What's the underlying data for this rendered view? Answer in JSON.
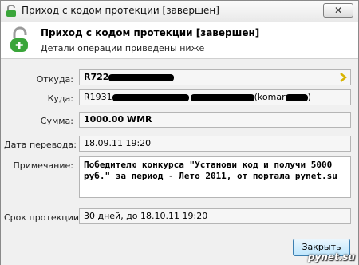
{
  "window": {
    "title": "Приход с кодом протекции [завершен]",
    "close_label": "✕"
  },
  "header": {
    "title": "Приход с кодом протекции [завершен]",
    "subtitle": "Детали операции приведены ниже"
  },
  "fields": {
    "from_label": "Откуда:",
    "from_value": "R722",
    "to_label": "Куда:",
    "to_value_start": "R1931",
    "to_value_mid": "(komar",
    "to_value_end": ")",
    "amount_label": "Сумма:",
    "amount_value": "1000.00 WMR",
    "date_label": "Дата перевода:",
    "date_value": "18.09.11 19:20",
    "note_label": "Примечание:",
    "note_value": "Победителю конкурса \"Установи код и получи 5000 руб.\" за период - Лето 2011, от портала pynet.su",
    "protection_label": "Срок протекции:",
    "protection_value": "30 дней, до 18.10.11 19:20"
  },
  "buttons": {
    "close_label": "Закрыть"
  },
  "watermark": "pynet.su",
  "colors": {
    "lock_green": "#3aa53a",
    "arrow_yellow": "#d8b400"
  },
  "icons": {
    "title": "unlocked-padlock-icon",
    "header": "unlocked-padlock-icon",
    "from_arrow": "chevron-right-icon"
  }
}
